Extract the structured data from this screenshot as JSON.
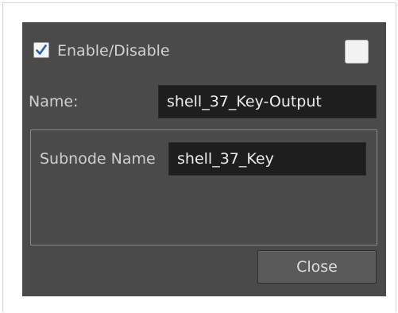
{
  "dialog": {
    "enable_checkbox": {
      "label": "Enable/Disable",
      "checked": true
    },
    "color_swatch": {
      "color": "#f2f2f2"
    },
    "name": {
      "label": "Name:",
      "value": "shell_37_Key-Output"
    },
    "subnode": {
      "label": "Subnode Name",
      "value": "shell_37_Key"
    },
    "close_label": "Close"
  },
  "colors": {
    "dialog_background": "#4a4a4a",
    "field_background": "#1e1e1e",
    "checkmark": "#2d5fb0"
  }
}
